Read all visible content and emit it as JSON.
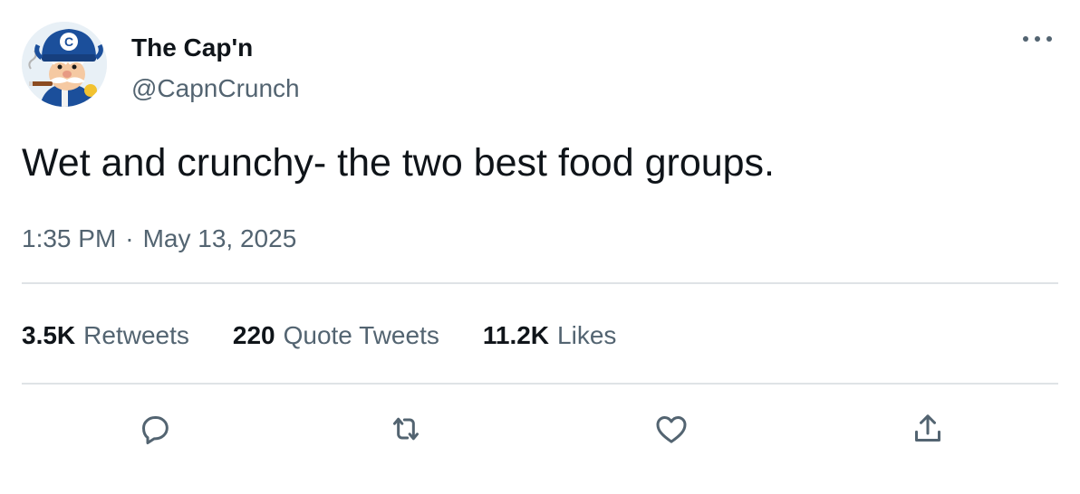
{
  "author": {
    "display_name": "The Cap'n",
    "handle": "@CapnCrunch",
    "avatar_icon": "capn-crunch-avatar-icon"
  },
  "tweet": {
    "text": "Wet and crunchy- the two best food groups.",
    "time": "1:35 PM",
    "separator": "·",
    "date": "May 13, 2025"
  },
  "stats": {
    "retweets": {
      "count": "3.5K",
      "label": "Retweets"
    },
    "quotes": {
      "count": "220",
      "label": "Quote Tweets"
    },
    "likes": {
      "count": "11.2K",
      "label": "Likes"
    }
  },
  "actions": {
    "reply_icon": "reply-icon",
    "retweet_icon": "retweet-icon",
    "like_icon": "heart-icon",
    "share_icon": "share-icon",
    "more_icon": "more-icon"
  },
  "colors": {
    "text_primary": "#0f1419",
    "text_secondary": "#536471",
    "divider": "#dfe3e6"
  }
}
